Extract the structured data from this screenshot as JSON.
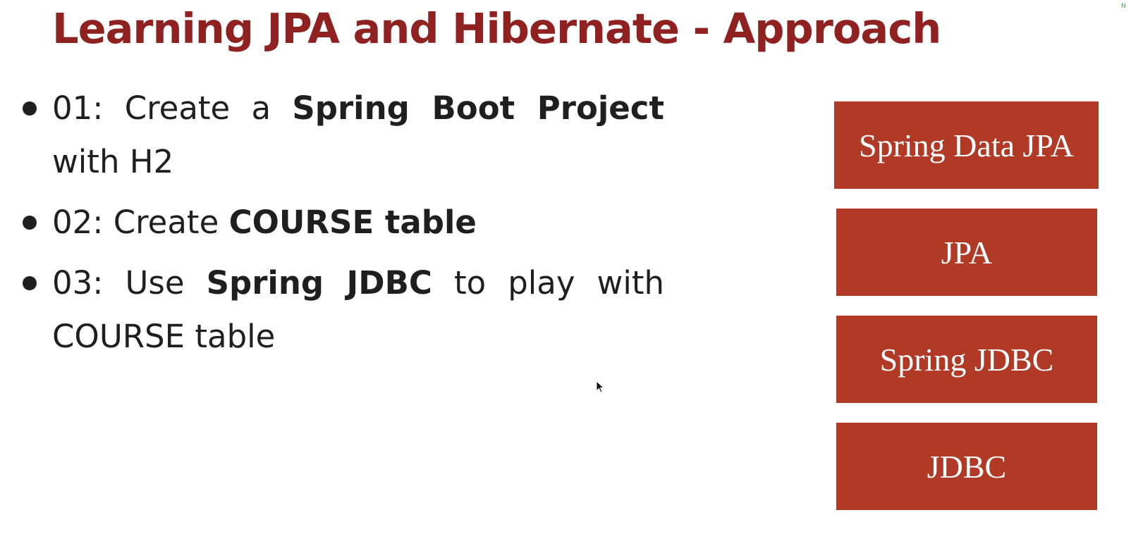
{
  "slide": {
    "title": "Learning JPA and Hibernate - Approach",
    "bullets": [
      {
        "prefix": "01: Create a ",
        "bold": "Spring Boot Project",
        "suffix": " with H2"
      },
      {
        "prefix": "02: Create ",
        "bold": "COURSE table",
        "suffix": ""
      },
      {
        "prefix": "03: Use ",
        "bold": "Spring JDBC",
        "suffix": " to play with COURSE table"
      }
    ],
    "stack": [
      "Spring Data JPA",
      "JPA",
      "Spring JDBC",
      "JDBC"
    ],
    "corner_mark": "N"
  },
  "colors": {
    "title": "#8f2121",
    "box": "#b03a26",
    "text": "#1f1f1f",
    "background": "#ffffff"
  },
  "icons": {
    "cursor": "mouse-pointer-icon"
  }
}
